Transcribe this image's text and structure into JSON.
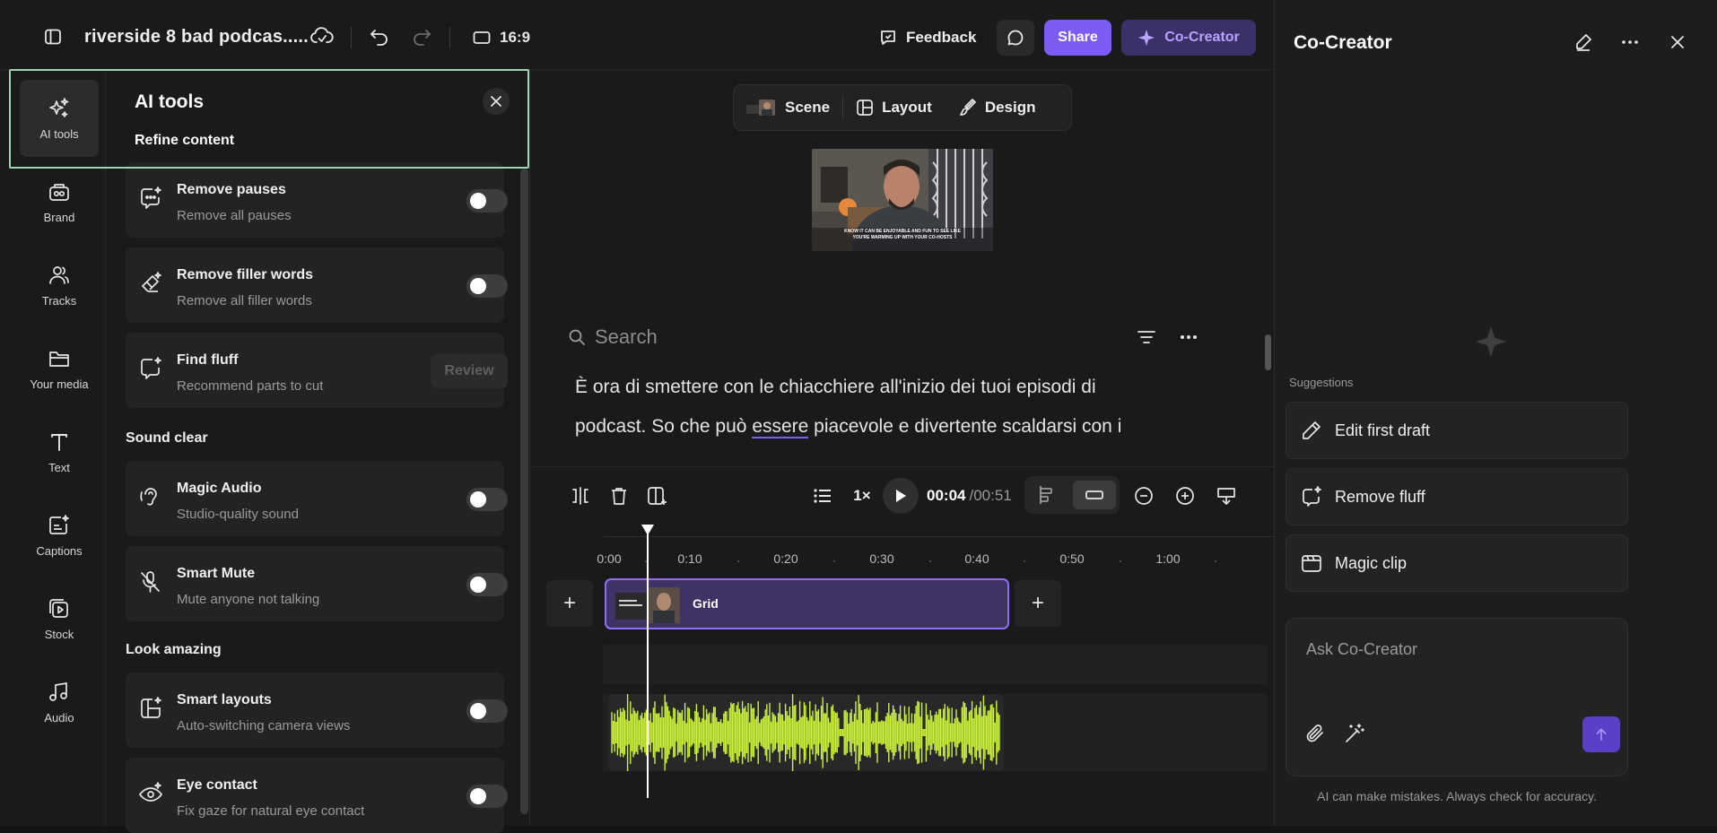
{
  "topbar": {
    "project_title": "riverside 8 bad podcas.....",
    "aspect_ratio": "16:9",
    "feedback_label": "Feedback",
    "share_label": "Share",
    "cocreator_label": "Co-Creator"
  },
  "sidebar": {
    "items": [
      {
        "label": "AI tools",
        "icon": "sparkles-icon",
        "active": true
      },
      {
        "label": "Brand",
        "icon": "brand-icon"
      },
      {
        "label": "Tracks",
        "icon": "users-icon"
      },
      {
        "label": "Your media",
        "icon": "folder-icon"
      },
      {
        "label": "Text",
        "icon": "text-icon"
      },
      {
        "label": "Captions",
        "icon": "captions-icon"
      },
      {
        "label": "Stock",
        "icon": "stock-icon"
      },
      {
        "label": "Audio",
        "icon": "music-icon"
      }
    ]
  },
  "ai_panel": {
    "title": "AI tools",
    "subtitle": "Refine content",
    "sections": {
      "sound_clear": "Sound clear",
      "look_amazing": "Look amazing"
    },
    "cards": [
      {
        "title": "Remove pauses",
        "subtitle": "Remove all pauses",
        "control": "toggle",
        "enabled": false
      },
      {
        "title": "Remove filler words",
        "subtitle": "Remove all filler words",
        "control": "toggle",
        "enabled": false
      },
      {
        "title": "Find fluff",
        "subtitle": "Recommend parts to cut",
        "control": "button",
        "button_label": "Review"
      },
      {
        "title": "Magic Audio",
        "subtitle": "Studio-quality sound",
        "control": "toggle",
        "enabled": false
      },
      {
        "title": "Smart Mute",
        "subtitle": "Mute anyone not talking",
        "control": "toggle",
        "enabled": false
      },
      {
        "title": "Smart layouts",
        "subtitle": "Auto-switching camera views",
        "control": "toggle",
        "enabled": false
      },
      {
        "title": "Eye contact",
        "subtitle": "Fix gaze for natural eye contact",
        "control": "toggle",
        "enabled": false
      }
    ]
  },
  "editor": {
    "tabs": [
      "Scene",
      "Layout",
      "Design"
    ],
    "preview_caption": "KNOW IT CAN BE ENJOYABLE AND FUN TO SEE LIKE YOU'RE WARMING UP WITH YOUR CO-HOSTS",
    "search_placeholder": "Search",
    "transcript_line1": "È ora di smettere con le chiacchiere all'inizio dei tuoi episodi di",
    "transcript_line2_a": "podcast. So che può ",
    "transcript_line2_b": "essere",
    "transcript_line2_c": " piacevole  e divertente scaldarsi con i",
    "speed": "1×",
    "time_current": "00:04",
    "time_total": "/00:51",
    "ruler_ticks": [
      "0:00",
      "0:10",
      "0:20",
      "0:30",
      "0:40",
      "0:50",
      "1:00"
    ],
    "clip_label": "Grid",
    "waveform_color": "#cdf33c"
  },
  "cocreator": {
    "title": "Co-Creator",
    "suggestions_label": "Suggestions",
    "suggestions": [
      "Edit first draft",
      "Remove fluff",
      "Magic clip"
    ],
    "input_placeholder": "Ask Co-Creator",
    "disclaimer": "AI can make mistakes. Always check for accuracy."
  },
  "colors": {
    "accent": "#7c5cf5",
    "highlight_border": "#9fd3b4",
    "background": "#1a1a1a"
  }
}
